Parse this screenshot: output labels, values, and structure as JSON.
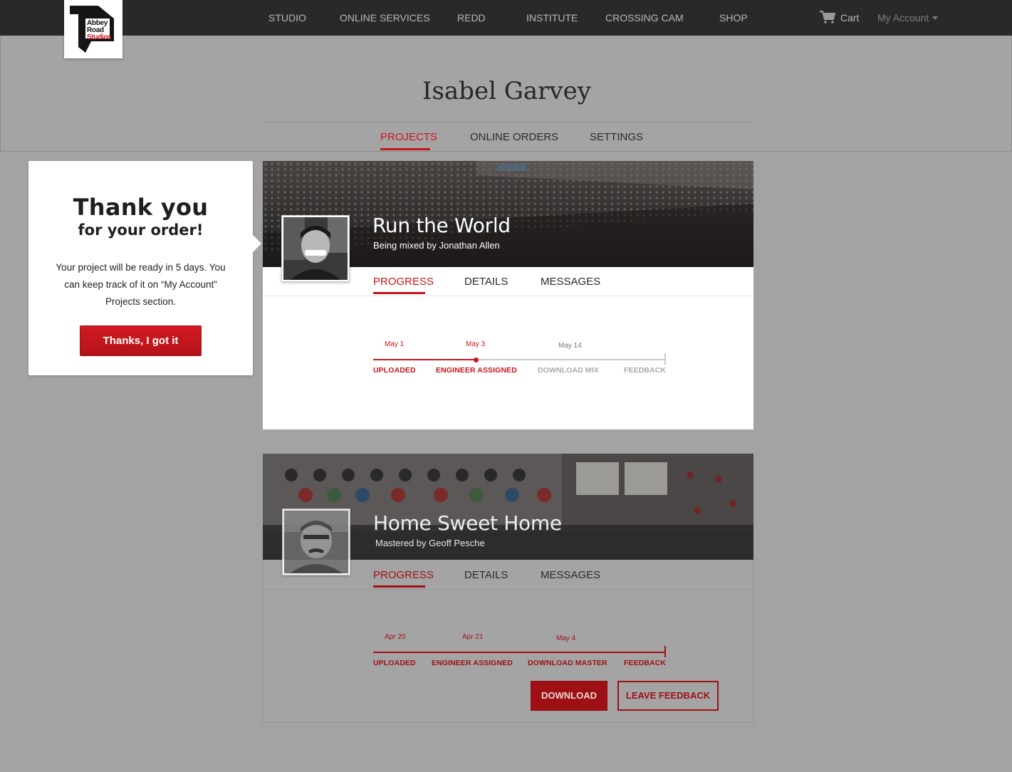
{
  "brand": {
    "logo_line1": "Abbey",
    "logo_line2": "Road",
    "logo_line3": "Studios"
  },
  "nav": {
    "items": [
      "STUDIO",
      "ONLINE SERVICES",
      "REDD",
      "INSTITUTE",
      "CROSSING CAM",
      "SHOP"
    ],
    "cart_label": "Cart",
    "account_label": "My Account"
  },
  "profile": {
    "name": "Isabel Garvey",
    "tabs": [
      "PROJECTS",
      "ONLINE ORDERS",
      "SETTINGS"
    ],
    "active_tab": "PROJECTS"
  },
  "thanks_panel": {
    "title": "Thank you",
    "subtitle": "for your order!",
    "message": "Your project will be ready in 5 days. You can keep track of it on “My Account” Projects section.",
    "button": "Thanks, I got it"
  },
  "projects": [
    {
      "title": "Run the World",
      "subtitle": "Being mixed by Jonathan Allen",
      "tabs": [
        "PROGRESS",
        "DETAILS",
        "MESSAGES"
      ],
      "progress": 0.36,
      "dates": [
        "May 1",
        "May 3",
        "May 14"
      ],
      "stages": [
        "UPLOADED",
        "ENGINEER ASSIGNED",
        "DOWNLOAD MIX",
        "FEEDBACK"
      ]
    },
    {
      "title": "Home Sweet Home",
      "subtitle": "Mastered by Geoff Pesche",
      "tabs": [
        "PROGRESS",
        "DETAILS",
        "MESSAGES"
      ],
      "progress": 1.0,
      "dates": [
        "Apr 20",
        "Apr 21",
        "May 4"
      ],
      "stages": [
        "UPLOADED",
        "ENGINEER ASSIGNED",
        "DOWNLOAD MASTER",
        "FEEDBACK"
      ],
      "buttons": {
        "download": "DOWNLOAD",
        "feedback": "LEAVE FEEDBACK"
      }
    }
  ],
  "colors": {
    "accent": "#c8161d",
    "topbar": "#2a2929",
    "overlay": "#a4a3a4"
  }
}
